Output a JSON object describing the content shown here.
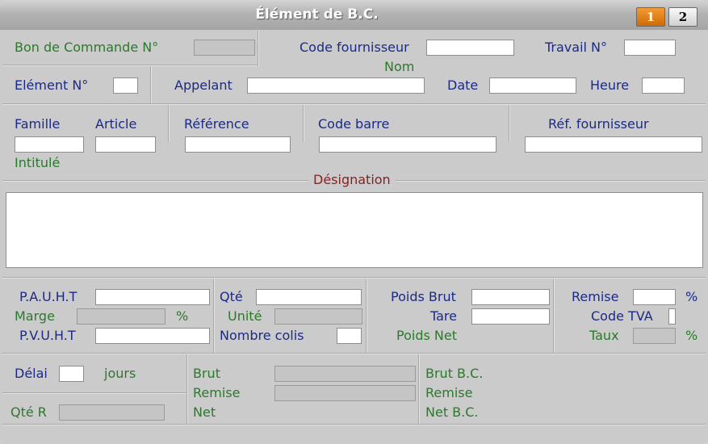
{
  "window": {
    "title": "Élément de B.C."
  },
  "tabs": [
    "1",
    "2"
  ],
  "fields": {
    "bon_commande": "Bon de Commande N°",
    "code_fournisseur": "Code fournisseur",
    "travail": "Travail N°",
    "nom": "Nom",
    "element": "Elément N°",
    "appelant": "Appelant",
    "date": "Date",
    "heure": "Heure",
    "famille": "Famille",
    "article": "Article",
    "reference": "Référence",
    "code_barre": "Code barre",
    "ref_fournisseur": "Réf. fournisseur",
    "intitule": "Intitulé",
    "designation": "Désignation",
    "pauht": "P.A.U.H.T",
    "marge": "Marge",
    "percent": "%",
    "pvuht": "P.V.U.H.T",
    "qte": "Qté",
    "unite": "Unité",
    "nombre_colis": "Nombre colis",
    "poids_brut": "Poids Brut",
    "tare": "Tare",
    "poids_net": "Poids Net",
    "remise": "Remise",
    "code_tva": "Code TVA",
    "taux": "Taux",
    "delai": "Délai",
    "jours": "jours",
    "qte_r": "Qté R",
    "brut": "Brut",
    "remise2": "Remise",
    "net": "Net",
    "brut_bc": "Brut B.C.",
    "remise_bc": "Remise",
    "net_bc": "Net B.C."
  },
  "values": {
    "bon_commande": "",
    "code_fournisseur": "",
    "travail": "",
    "element": "",
    "appelant": "",
    "date": "",
    "heure": "",
    "famille": "",
    "article": "",
    "reference": "",
    "code_barre": "",
    "ref_fournisseur": "",
    "designation": "",
    "pauht": "",
    "marge": "",
    "pvuht": "",
    "qte": "",
    "unite": "",
    "nombre_colis": "",
    "poids_brut": "",
    "tare": "",
    "remise": "",
    "code_tva": "",
    "taux": "",
    "delai": "",
    "qte_r": "",
    "brut": "",
    "remise2": ""
  },
  "colors": {
    "label_blue": "#1c2a86",
    "label_green": "#2a7a2a",
    "section_red": "#8a1f1f",
    "active_tab": "#e8801c"
  }
}
